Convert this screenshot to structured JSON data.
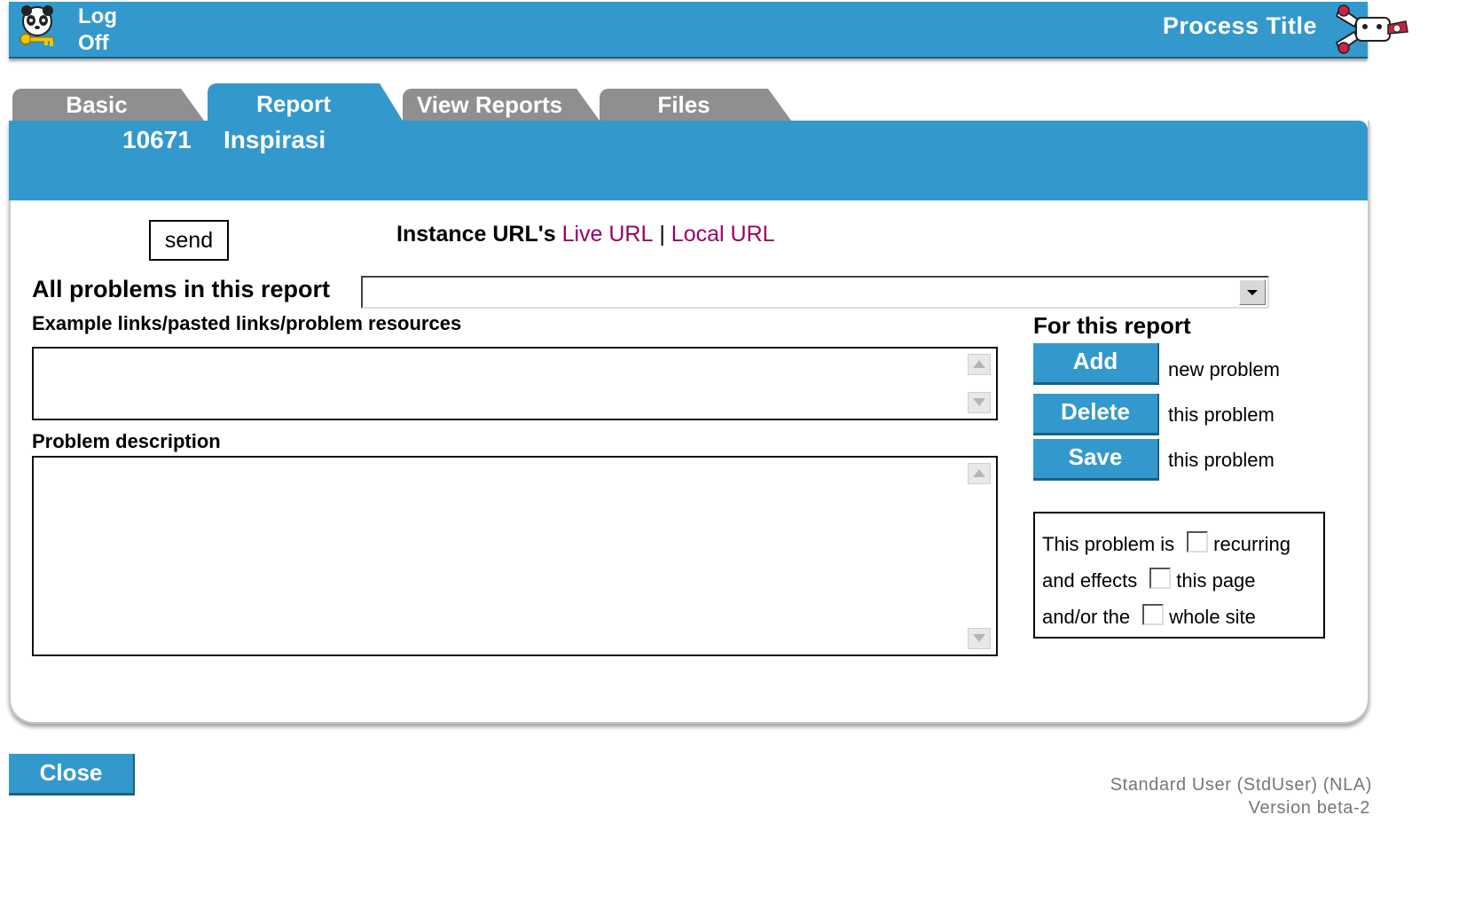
{
  "header": {
    "logoff_line1": "Log",
    "logoff_line2": "Off",
    "process_title": "Process Title"
  },
  "tabs": [
    {
      "label": "Basic",
      "active": false
    },
    {
      "label": "Report",
      "active": true
    },
    {
      "label": "View Reports",
      "active": false
    },
    {
      "label": "Files",
      "active": false
    }
  ],
  "report": {
    "id": "10671",
    "name": "Inspirasi"
  },
  "send_label": "send",
  "instance": {
    "label": "Instance URL's",
    "live_url": "Live URL",
    "separator": "|",
    "local_url": "Local URL"
  },
  "problems": {
    "all_label": "All problems in this report",
    "selected": "",
    "example_label": "Example links/pasted links/problem resources",
    "example_value": "",
    "description_label": "Problem description",
    "description_value": ""
  },
  "actions": {
    "heading": "For this report",
    "add_label": "Add",
    "add_note": "new problem",
    "delete_label": "Delete",
    "delete_note": "this problem",
    "save_label": "Save",
    "save_note": "this problem"
  },
  "flags": {
    "row1_prefix": "This problem is",
    "row1_option": "recurring",
    "row2_prefix": "and effects",
    "row2_option": "this page",
    "row3_prefix": "and/or the",
    "row3_option": "whole site"
  },
  "close_label": "Close",
  "footer": {
    "user": "Standard User (StdUser) (NLA)",
    "version": "Version beta-2"
  },
  "colors": {
    "accent": "#3399cc",
    "tab_inactive": "#8f8f8f",
    "link": "#990066"
  }
}
